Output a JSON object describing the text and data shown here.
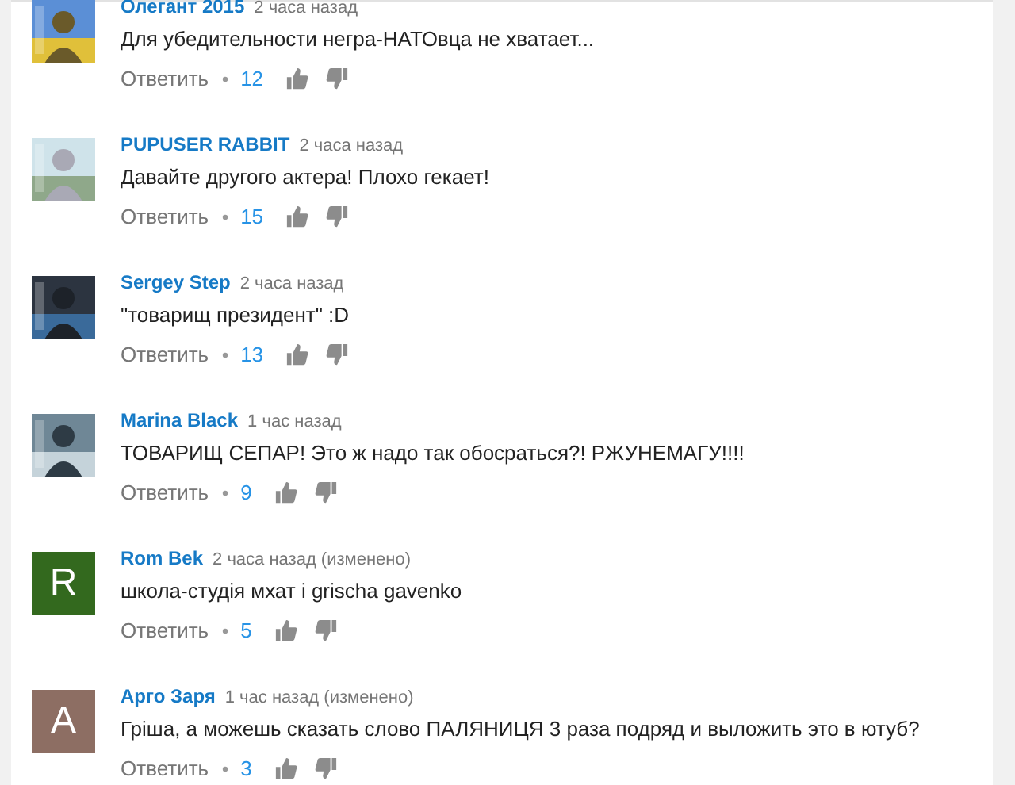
{
  "comments": [
    {
      "author": "Олегант 2015",
      "time": "2 часа назад",
      "text": "Для  убедительности  негра-НАТОвца  не  хватает...",
      "reply": "Ответить",
      "likes": "12"
    },
    {
      "author": "PUPUSER RABBIT",
      "time": "2 часа назад",
      "text": "Давайте другого актера! Плохо гекает!",
      "reply": "Ответить",
      "likes": "15"
    },
    {
      "author": "Sergey Step",
      "time": "2 часа назад",
      "text": "\"товарищ президент\" :D",
      "reply": "Ответить",
      "likes": "13"
    },
    {
      "author": "Marina Black",
      "time": "1 час назад",
      "text": "ТОВАРИЩ СЕПАР! Это ж надо так обосраться?! РЖУНЕМАГУ!!!!",
      "reply": "Ответить",
      "likes": "9"
    },
    {
      "author": "Rom Bek",
      "time": "2 часа назад (изменено)",
      "text": "школа-студія мхат і  grischa gavenko",
      "reply": "Ответить",
      "likes": "5",
      "avatar": {
        "kind": "letter",
        "letter": "R",
        "color": "#33691e"
      }
    },
    {
      "author": "Арго Заря",
      "time": "1 час назад (изменено)",
      "text": "Гріша, а можешь сказать слово ПАЛЯНИЦЯ 3 раза подряд и выложить это в ютуб?",
      "reply": "Ответить",
      "likes": "3",
      "avatar": {
        "kind": "letter",
        "letter": "A",
        "color": "#8d6e63"
      }
    }
  ]
}
